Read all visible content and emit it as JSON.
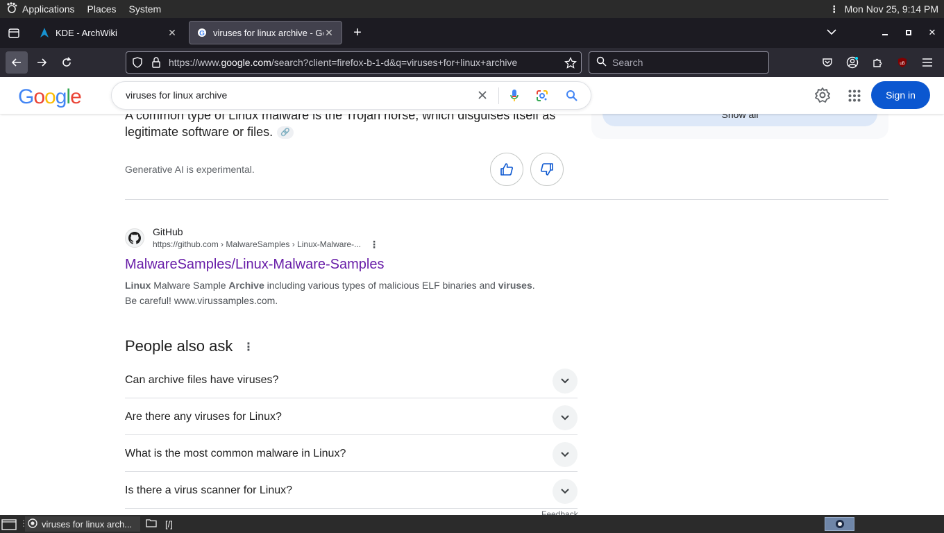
{
  "top_panel": {
    "menu": [
      "Applications",
      "Places",
      "System"
    ],
    "clock": "Mon Nov 25,  9:14 PM"
  },
  "tabs": [
    {
      "title": "KDE - ArchWiki",
      "active": false
    },
    {
      "title": "viruses for linux archive - Go",
      "active": true
    }
  ],
  "nav": {
    "url_prefix": "https://www.",
    "url_domain": "google.com",
    "url_rest": "/search?client=firefox-b-1-d&q=viruses+for+linux+archive",
    "search_placeholder": "Search"
  },
  "google": {
    "logo": "Google",
    "query": "viruses for linux archive",
    "sign_in": "Sign in"
  },
  "ai_overview": {
    "text_line1": "A common type of Linux malware is the Trojan horse, which disguises itself as",
    "text_line2": "legitimate software or files.",
    "show_all": "Show all",
    "disclaimer": "Generative AI is experimental."
  },
  "result": {
    "site_name": "GitHub",
    "site_url": "https://github.com › MalwareSamples › Linux-Malware-...",
    "title": "MalwareSamples/Linux-Malware-Samples",
    "snippet": {
      "b1": "Linux",
      "t1": " Malware Sample ",
      "b2": "Archive",
      "t2": " including various types of malicious ELF binaries and ",
      "b3": "viruses",
      "t3": ".",
      "line2": "Be careful! www.virussamples.com."
    }
  },
  "people_also_ask": {
    "title": "People also ask",
    "questions": [
      "Can archive files have viruses?",
      "Are there any viruses for Linux?",
      "What is the most common malware in Linux?",
      "Is there a virus scanner for Linux?"
    ],
    "feedback": "Feedback"
  },
  "taskbar": {
    "firefox_task": "viruses for linux arch...",
    "files_task": "[/]"
  },
  "colors": {
    "google_blue": "#4285f4",
    "google_red": "#ea4335",
    "google_yellow": "#fbbc05",
    "google_green": "#34a853",
    "visited_link": "#681da8",
    "sign_in_bg": "#0b57d0"
  }
}
